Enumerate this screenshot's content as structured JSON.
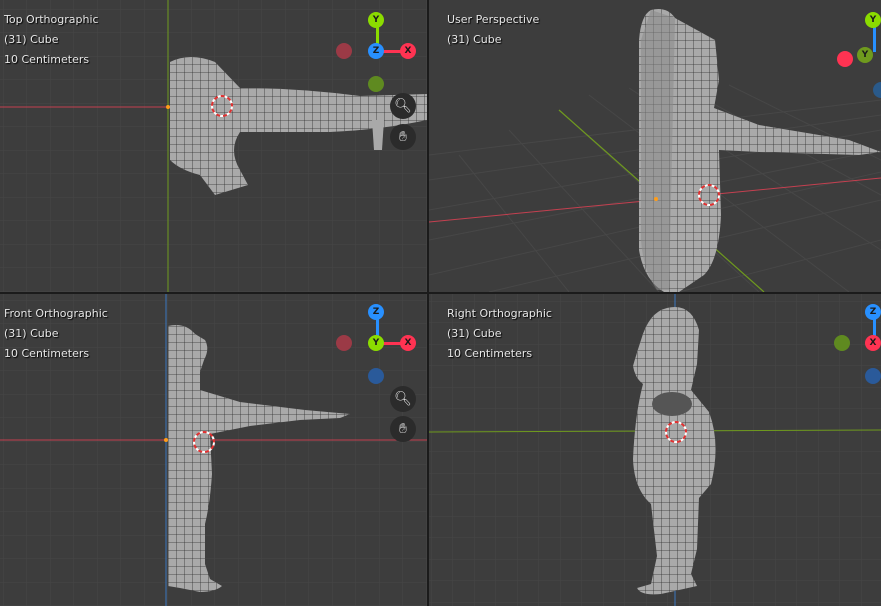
{
  "viewports": {
    "top": {
      "name": "Top Orthographic",
      "object": "(31) Cube",
      "scale": "10 Centimeters"
    },
    "user": {
      "name": "User Perspective",
      "object": "(31) Cube"
    },
    "front": {
      "name": "Front Orthographic",
      "object": "(31) Cube",
      "scale": "10 Centimeters"
    },
    "right": {
      "name": "Right Orthographic",
      "object": "(31) Cube",
      "scale": "10 Centimeters"
    }
  },
  "gizmo_labels": {
    "x": "X",
    "y": "Y",
    "z": "Z"
  },
  "icons": {
    "zoom": "zoom-icon",
    "pan": "hand-pan-icon"
  },
  "colors": {
    "background": "#3d3d3d",
    "axis_x": "#ff3352",
    "axis_y": "#8bdc00",
    "axis_z": "#2890ff",
    "mesh": "#a9a9a9"
  }
}
